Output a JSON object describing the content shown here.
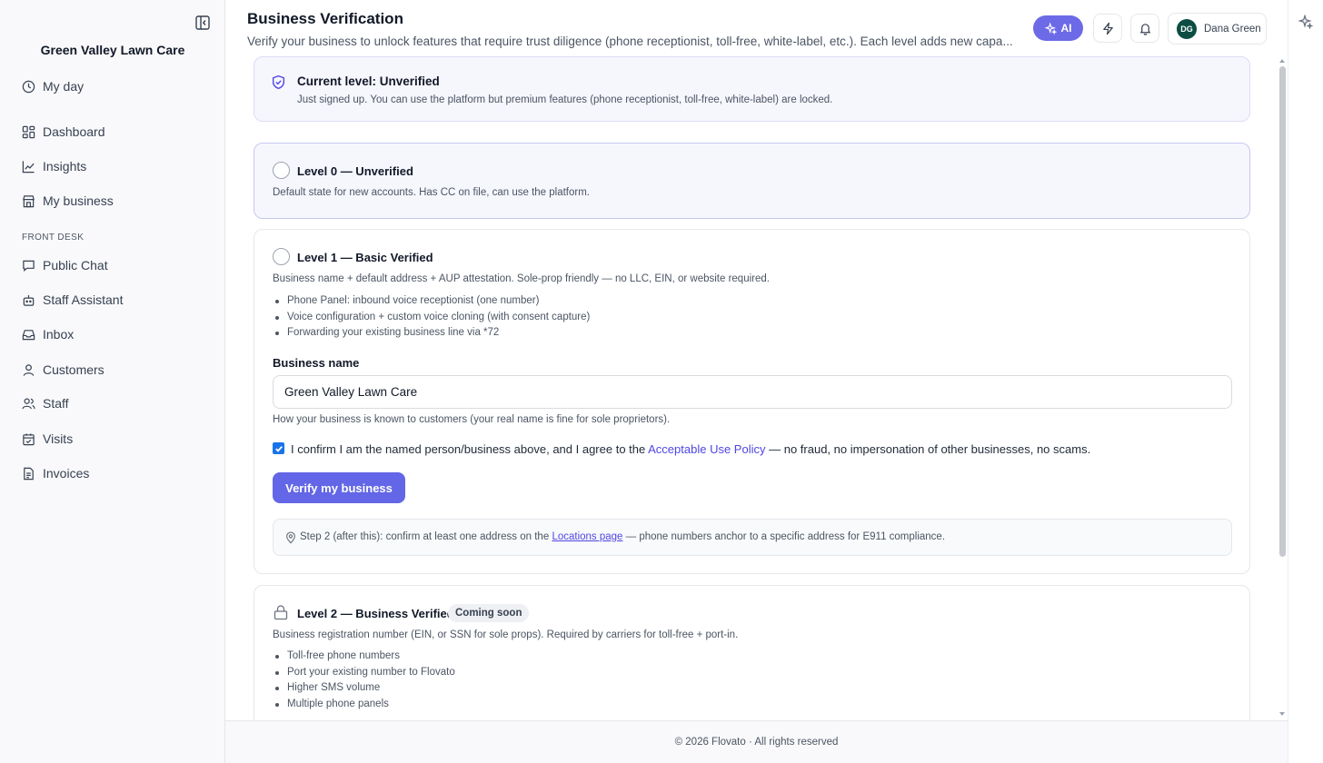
{
  "app": {
    "business_name": "Green Valley Lawn Care",
    "accent_color": "#6366e6"
  },
  "sidebar": {
    "items": [
      {
        "label": "My day",
        "icon": "clock-icon"
      },
      {
        "label": "Dashboard",
        "icon": "dashboard-icon"
      },
      {
        "label": "Insights",
        "icon": "chart-line-icon"
      },
      {
        "label": "My business",
        "icon": "store-icon"
      }
    ],
    "section_label": "FRONT DESK",
    "front_desk_items": [
      {
        "label": "Public Chat",
        "icon": "chat-bubble-icon"
      },
      {
        "label": "Staff Assistant",
        "icon": "bot-icon"
      },
      {
        "label": "Inbox",
        "icon": "inbox-icon"
      },
      {
        "label": "Customers",
        "icon": "user-icon"
      },
      {
        "label": "Staff",
        "icon": "users-icon"
      },
      {
        "label": "Visits",
        "icon": "calendar-check-icon"
      },
      {
        "label": "Invoices",
        "icon": "document-icon"
      }
    ]
  },
  "header": {
    "title": "Business Verification",
    "subtitle": "Verify your business to unlock features that require trust diligence (phone receptionist, toll-free, white-label, etc.). Each level adds new capa...",
    "ai_label": "AI",
    "user": {
      "initials": "DG",
      "name": "Dana Green",
      "avatar_color": "#0b4d43"
    }
  },
  "current_level": {
    "title": "Current level: Unverified",
    "description": "Just signed up. You can use the platform but premium features (phone receptionist, toll-free, white-label) are locked."
  },
  "levels": [
    {
      "title": "Level 0 — Unverified",
      "description": "Default state for new accounts. Has CC on file, can use the platform."
    },
    {
      "title": "Level 1 — Basic Verified",
      "description": "Business name + default address + AUP attestation. Sole-prop friendly — no LLC, EIN, or website required.",
      "features": [
        "Phone Panel: inbound voice receptionist (one number)",
        "Voice configuration + custom voice cloning (with consent capture)",
        "Forwarding your existing business line via *72"
      ],
      "field_label": "Business name",
      "field_value": "Green Valley Lawn Care",
      "field_help": "How your business is known to customers (your real name is fine for sole proprietors).",
      "confirm_before": "I confirm I am the named person/business above, and I agree to the",
      "confirm_link": "Acceptable Use Policy",
      "confirm_after": "— no fraud, no impersonation of other businesses, no scams.",
      "confirm_checked": true,
      "verify_label": "Verify my business",
      "step_before": "Step 2 (after this): confirm at least one address on the",
      "step_link": "Locations page",
      "step_after": "— phone numbers anchor to a specific address for E911 compliance."
    },
    {
      "title": "Level 2 — Business Verified",
      "badge": "Coming soon",
      "description": "Business registration number (EIN, or SSN for sole props). Required by carriers for toll-free + port-in.",
      "features": [
        "Toll-free phone numbers",
        "Port your existing number to Flovato",
        "Higher SMS volume",
        "Multiple phone panels"
      ]
    }
  ],
  "footer": {
    "text": "© 2026 Flovato · All rights reserved"
  }
}
